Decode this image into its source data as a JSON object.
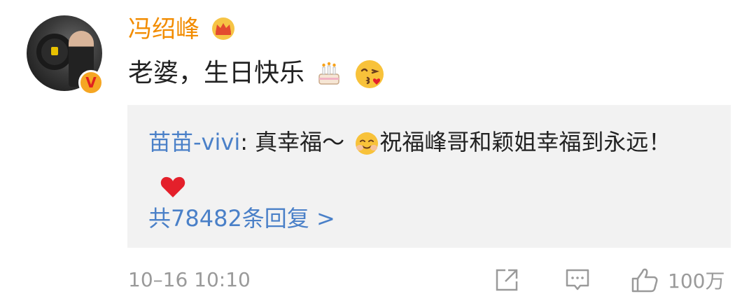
{
  "comment": {
    "username": "冯绍峰",
    "text": "老婆，生日快乐",
    "emojis": [
      "birthday-cake-emoji",
      "kissing-heart-emoji"
    ],
    "timestamp": "10–16 10:10",
    "like_count": "100万"
  },
  "reply": {
    "username": "苗苗-vivi",
    "separator": ": ",
    "text_before": "真幸福～",
    "text_after": "祝福峰哥和颖姐幸福到永远！",
    "emojis": [
      "smiling-blush-emoji",
      "red-heart-emoji"
    ],
    "reply_count_label": "共78482条回复 >"
  },
  "colors": {
    "username": "#f28c00",
    "link": "#4a80c8",
    "muted": "#9a9a9a",
    "reply_bg": "#f2f2f2",
    "badge": "#f5a623"
  }
}
